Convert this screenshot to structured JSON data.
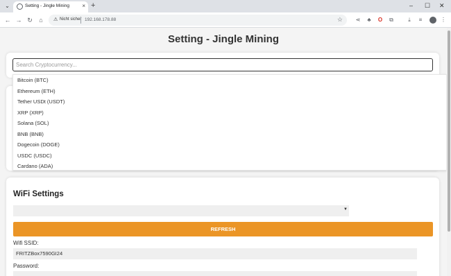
{
  "browser": {
    "tab_title": "Setting - Jingle Mining",
    "tab_close": "×",
    "new_tab": "+",
    "tab_menu": "⌄",
    "security_label": "Nicht sicher",
    "url": "192.168.178.88",
    "window_controls": {
      "minimize": "–",
      "maximize": "☐",
      "close": "✕"
    }
  },
  "page": {
    "title": "Setting - Jingle Mining",
    "search": {
      "placeholder": "Search Cryptocurrency...",
      "value": ""
    },
    "crypto_options": [
      "Bitcoin (BTC)",
      "Ethereum (ETH)",
      "Tether USDt (USDT)",
      "XRP (XRP)",
      "Solana (SOL)",
      "BNB (BNB)",
      "Dogecoin (DOGE)",
      "USDC (USDC)",
      "Cardano (ADA)"
    ],
    "wifi": {
      "heading": "WiFi Settings",
      "network_select_value": "",
      "refresh_label": "REFRESH",
      "ssid_label": "Wifi SSID:",
      "ssid_value": "FRITZBox7590GI24",
      "password_label": "Password:"
    }
  },
  "colors": {
    "accent": "#eb9526",
    "page_background": "#f4f4f4"
  },
  "icons": [
    "back-icon",
    "forward-icon",
    "reload-icon",
    "home-icon",
    "warning-icon",
    "star-icon",
    "share-icon",
    "extension-icon",
    "download-icon",
    "profile-icon",
    "menu-icon",
    "chevron-down-icon"
  ]
}
